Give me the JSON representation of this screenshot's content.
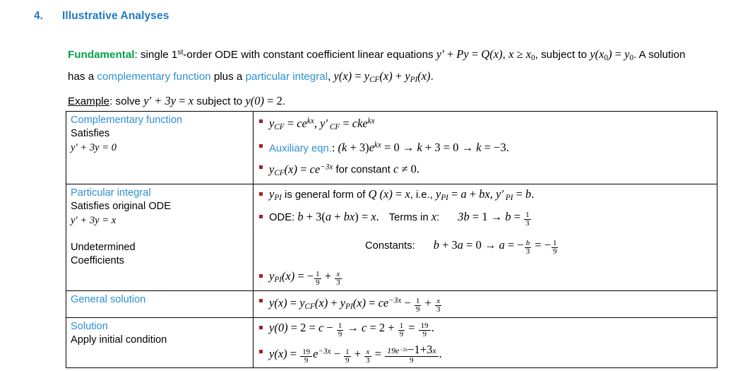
{
  "heading": {
    "number": "4.",
    "title": "Illustrative Analyses",
    "color": "#1F7AC4"
  },
  "fundamental": {
    "keyword": "Fundamental",
    "keyword_color": "#00A14B",
    "t1": ": single 1",
    "sup_st": "st",
    "t2": "-order ODE with constant coefficient linear equations ",
    "eq1_y": "y",
    "eq1_prime": "′",
    "eq1_plus": " + ",
    "eq1_P": "P",
    "eq1_y2": "y",
    "eq1_eq": " = ",
    "eq1_Q": "Q",
    "eq1_x": "(x)",
    "t3": ", ",
    "eq2_x": "x",
    "eq2_ge": " ≥ ",
    "eq2_x0": "x",
    "eq2_sub0": "0",
    "t4": ", subject to ",
    "eq3_y": "y",
    "eq3_x0": "(x",
    "eq3_sub0": "0",
    "eq3_close": ")",
    "eq3_eq": " = ",
    "eq3_y0": "y",
    "eq3_sub0b": "0",
    "t5": ". A solution has a ",
    "link1": "complementary function",
    "t6": " plus a ",
    "link2": "particular integral",
    "t7": ", ",
    "eq4_y": "y",
    "eq4_x": "(x)",
    "eq4_eq": " = ",
    "eq4_ycf": "y",
    "eq4_cf": "CF",
    "eq4_x2": "(x)",
    "eq4_plus": " + ",
    "eq4_ypi": "y",
    "eq4_pi": "PI",
    "eq4_x3": "(x)",
    "t8": ".",
    "link_color": "#2E8FD6"
  },
  "example": {
    "label": "Example",
    "t1": ": solve ",
    "y": "y",
    "prime": "′",
    "plus3y": " + 3y",
    "eq": " = ",
    "x": "x",
    "t2": " subject to ",
    "y0": "y",
    "zero": "(0)",
    "eq2": " = ",
    "two": "2",
    "t3": "."
  },
  "table": {
    "rows": [
      {
        "id": "complementary-function",
        "left": {
          "title": "Complementary function",
          "line2": "Satisfies",
          "math3_y": "y",
          "math3_prime": "′",
          "math3_rest": " + 3y = 0"
        },
        "bullets": [
          {
            "id": "ycf-form",
            "parts": "y_CF = ce^kx, y'_CF = cke^kx"
          },
          {
            "id": "auxiliary-equation",
            "label": "Auxiliary eqn.",
            "label_color": "#2E8FD6",
            "parts": "(k + 3)e^kx = 0 → k + 3 = 0 → k = -3."
          },
          {
            "id": "ycf-solution",
            "parts": "y_CF(x) = ce^-3x for constant c ≠ 0."
          }
        ]
      },
      {
        "id": "particular-integral",
        "left": {
          "title": "Particular integral",
          "line2": "Satisfies original ODE",
          "math3_y": "y",
          "math3_prime": "′",
          "math3_rest": " + 3y = x",
          "line5": "Undetermined",
          "line6": "Coefficients"
        },
        "bullets": [
          {
            "id": "ypi-general-form",
            "parts": "y_PI is general form of Q(x) = x, i.e., y_PI = a + bx, y'_PI = b."
          },
          {
            "id": "ode-terms-in-x",
            "label": "ODE",
            "parts": "b + 3(a + bx) = x.  Terms in x:  3b = 1 → b = 1/3",
            "constants_label": "Constants:",
            "constants_eq": "b + 3a = 0 → a = -b/3 = -1/9"
          },
          {
            "id": "ypi-solution",
            "parts": "y_PI(x) = -1/9 + x/3"
          }
        ]
      },
      {
        "id": "general-solution",
        "left": {
          "title": "General solution"
        },
        "bullets": [
          {
            "id": "general-solution-eq",
            "parts": "y(x) = y_CF(x) + y_PI(x) = ce^-3x - 1/9 + x/3"
          }
        ]
      },
      {
        "id": "solution",
        "left": {
          "title": "Solution",
          "line2": "Apply initial condition"
        },
        "bullets": [
          {
            "id": "initial-condition",
            "parts": "y(0) = 2 = c - 1/9 → c = 2 + 1/9 = 19/9."
          },
          {
            "id": "final-solution",
            "parts": "y(x) = 19/9 e^-3x - 1/9 + x/3 = (19e^-3x - 1 + 3x)/9."
          }
        ]
      }
    ],
    "labels": {
      "complementary_function": "Complementary function",
      "satisfies": "Satisfies",
      "particular_integral": "Particular integral",
      "satisfies_original_ode": "Satisfies original ODE",
      "undetermined": "Undetermined",
      "coefficients": "Coefficients",
      "general_solution": "General solution",
      "solution": "Solution",
      "apply_initial_condition": "Apply initial condition",
      "auxiliary_eqn": "Auxiliary eqn.",
      "ode": "ODE:",
      "terms_in_x": "Terms in",
      "constants": "Constants:",
      "for_constant": "for constant",
      "is_general_form_of": "is general form of",
      "ie": "i.e.,"
    },
    "numbers": {
      "three": "3",
      "zero": "0",
      "one": "1",
      "two": "2",
      "nine": "9",
      "nineteen": "19",
      "minus_three": "−3",
      "k_value": "−3"
    }
  }
}
